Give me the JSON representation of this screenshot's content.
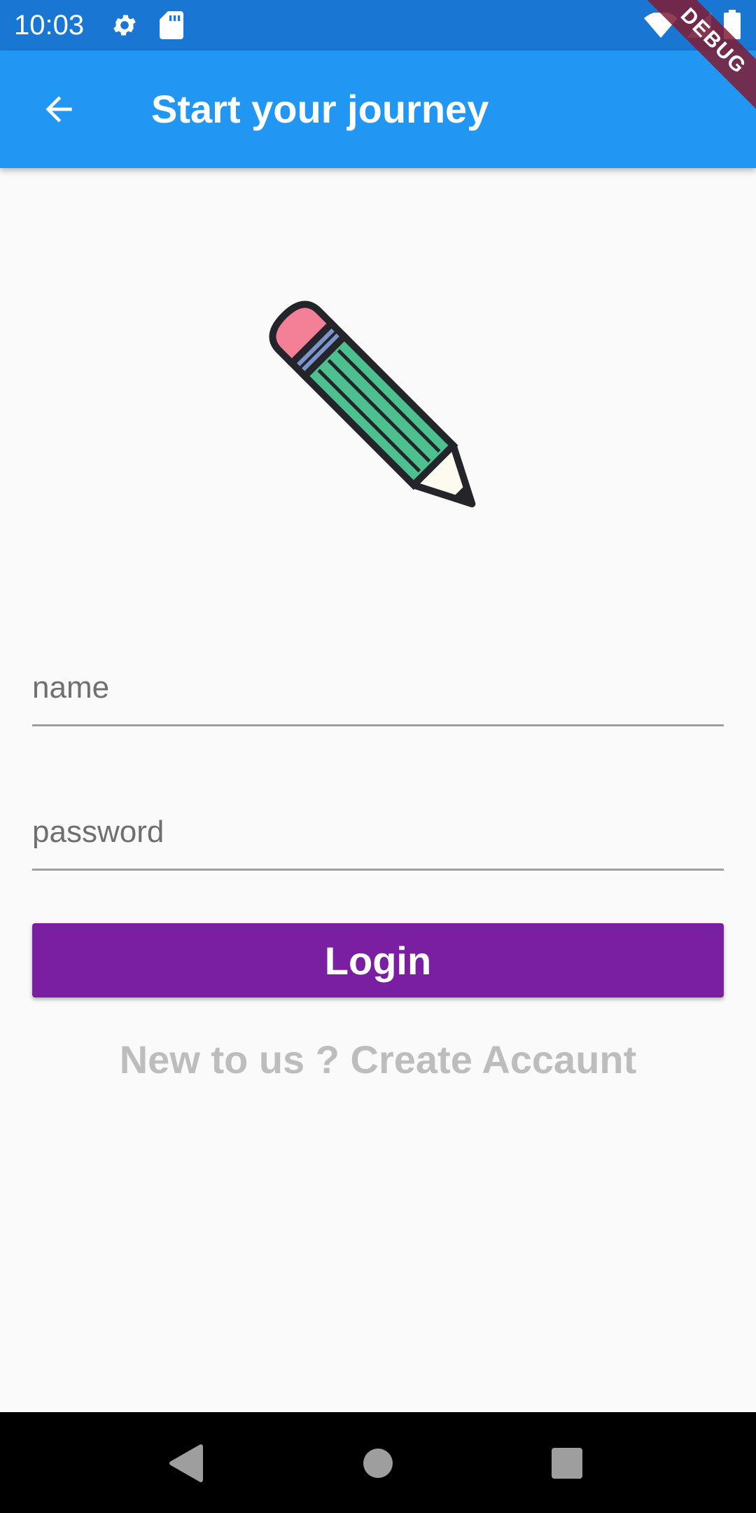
{
  "status_bar": {
    "time": "10:03",
    "icons": [
      "settings-icon",
      "sd-card-icon",
      "wifi-icon",
      "signal-icon",
      "battery-icon"
    ]
  },
  "app_bar": {
    "title": "Start your journey",
    "back_icon": "arrow-back-icon",
    "color": "#2196f3"
  },
  "debug_banner": "DEBUG",
  "illustration": "pencil-icon",
  "form": {
    "name_placeholder": "name",
    "name_value": "",
    "password_placeholder": "password",
    "password_value": ""
  },
  "login_button": {
    "label": "Login",
    "color": "#7b1fa2"
  },
  "create_account_link": "New to us ? Create Accaunt",
  "nav_bar": {
    "buttons": [
      "back-triangle-icon",
      "home-circle-icon",
      "recents-square-icon"
    ]
  }
}
